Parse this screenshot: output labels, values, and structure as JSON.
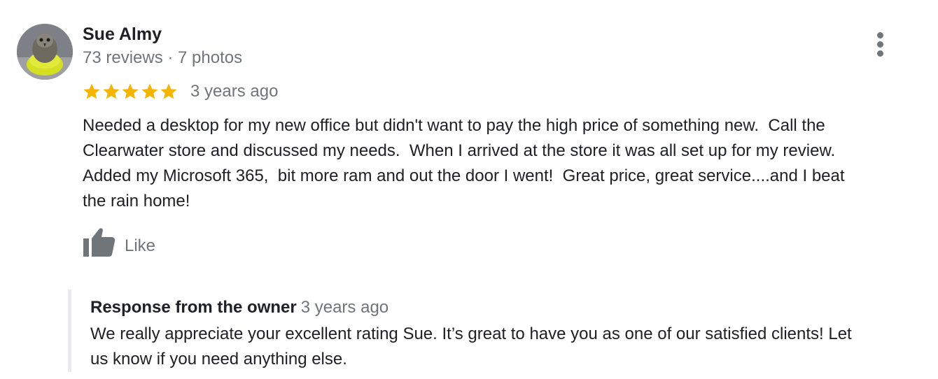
{
  "reviewer": {
    "name": "Sue Almy",
    "meta": "73 reviews · 7 photos"
  },
  "rating": {
    "stars": 5,
    "max": 5,
    "star_color": "#f4b400",
    "date": "3 years ago"
  },
  "review": {
    "text_lines": [
      "Needed a desktop for my new office but didn't want to pay the high price of something new.  Call the",
      "Clearwater store and discussed my needs.  When I arrived at the store it was all set up for my review.",
      "Added my Microsoft 365,  bit more ram and out the door I went!  Great price, great service....and I beat",
      "the rain home!"
    ]
  },
  "actions": {
    "like_label": "Like"
  },
  "owner_response": {
    "title": "Response from the owner",
    "date": "3 years ago",
    "text_lines": [
      "We really appreciate your excellent rating Sue. It’s great to have you as one of our satisfied clients! Let",
      "us know if you need anything else."
    ]
  },
  "icons": {
    "more": "more-vert-icon",
    "like": "thumb-up-icon",
    "star": "star-icon"
  },
  "colors": {
    "text": "#202124",
    "secondary": "#70757a",
    "star": "#f4b400",
    "response_border": "#e8eaed"
  }
}
